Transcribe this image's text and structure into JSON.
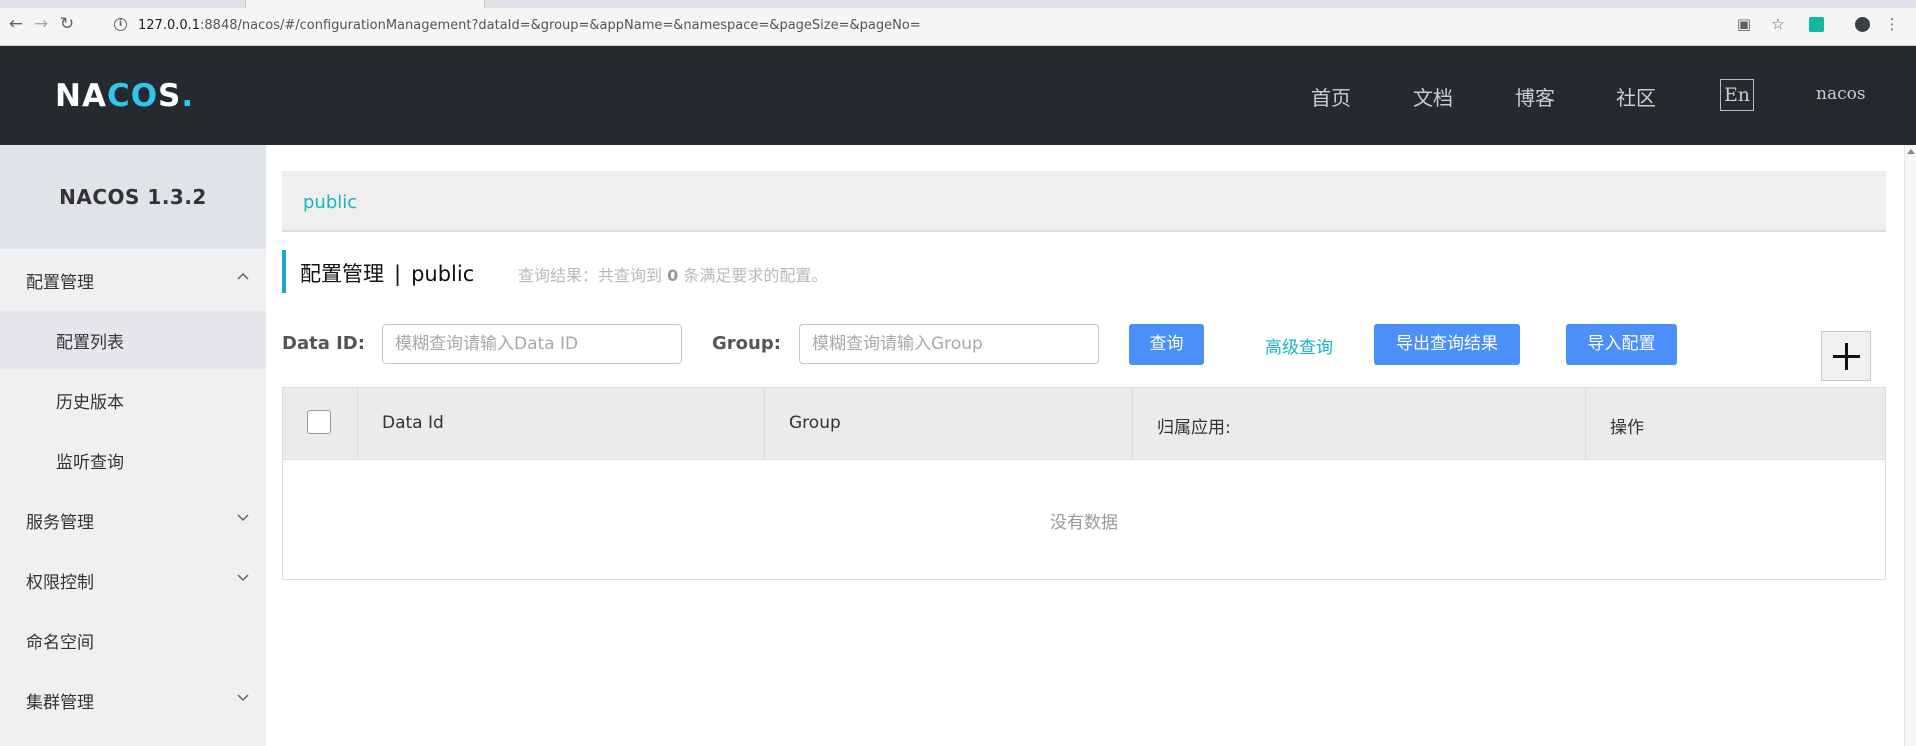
{
  "browser": {
    "url_host": "127.0.0.1",
    "url_rest": ":8848/nacos/#/configurationManagement?dataId=&group=&appName=&namespace=&pageSize=&pageNo=",
    "back_icon": "back-arrow-icon",
    "forward_icon": "forward-arrow-icon",
    "reload_icon": "reload-icon"
  },
  "header": {
    "logo_na": "NA",
    "logo_co": "CO",
    "logo_s": "S",
    "logo_dot": ".",
    "nav": [
      "首页",
      "文档",
      "博客",
      "社区"
    ],
    "lang": "En",
    "user": "nacos"
  },
  "sidebar": {
    "title": "NACOS 1.3.2",
    "items": [
      {
        "label": "配置管理",
        "expanded": true
      },
      {
        "label": "配置列表"
      },
      {
        "label": "历史版本"
      },
      {
        "label": "监听查询"
      },
      {
        "label": "服务管理",
        "expanded": false
      },
      {
        "label": "权限控制",
        "expanded": false
      },
      {
        "label": "命名空间"
      },
      {
        "label": "集群管理",
        "expanded": false
      }
    ]
  },
  "main": {
    "namespace_tab": "public",
    "title_left": "配置管理",
    "title_sep": "|",
    "title_right": "public",
    "query_prefix": "查询结果：共查询到",
    "query_count": "0",
    "query_suffix": "条满足要求的配置。",
    "dataid_label": "Data ID:",
    "dataid_placeholder": "模糊查询请输入Data ID",
    "group_label": "Group:",
    "group_placeholder": "模糊查询请输入Group",
    "search_btn": "查询",
    "advanced_link": "高级查询",
    "export_btn": "导出查询结果",
    "import_btn": "导入配置",
    "table": {
      "columns": [
        "Data Id",
        "Group",
        "归属应用:",
        "操作"
      ],
      "empty_text": "没有数据"
    }
  },
  "colors": {
    "header_bg": "#252a2f",
    "accent_cyan": "#1ab2c6",
    "button_blue": "#4b8ff9",
    "title_bar": "#1aa5d6"
  }
}
